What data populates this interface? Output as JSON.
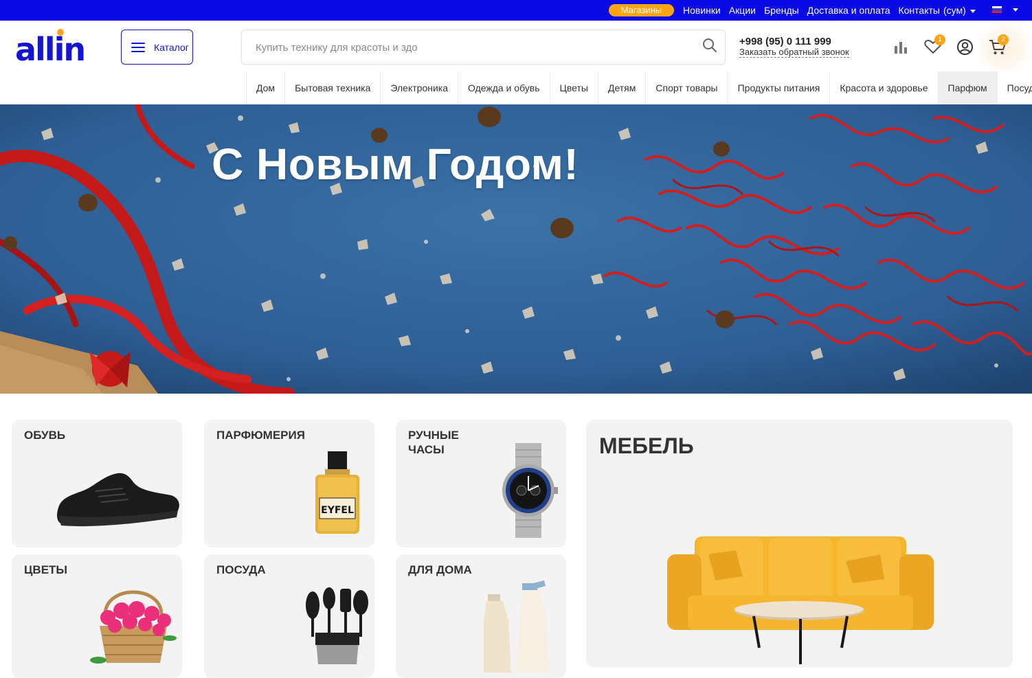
{
  "topbar": {
    "stores_label": "Магазины",
    "links": [
      "Новинки",
      "Акции",
      "Бренды",
      "Доставка и оплата",
      "Контакты"
    ],
    "currency": "(сум)"
  },
  "header": {
    "logo_text": "allin",
    "catalog_label": "Каталог",
    "search_placeholder": "Купить технику для красоты и здо",
    "phone": "+998 (95) 0 111 999",
    "callback": "Заказать обратный звонок",
    "favorites_count": "1",
    "cart_count": "2"
  },
  "catnav": {
    "items": [
      {
        "label": "Дом",
        "active": false
      },
      {
        "label": "Бытовая техника",
        "active": false
      },
      {
        "label": "Электроника",
        "active": false
      },
      {
        "label": "Одежда и обувь",
        "active": false
      },
      {
        "label": "Цветы",
        "active": false
      },
      {
        "label": "Детям",
        "active": false
      },
      {
        "label": "Спорт товары",
        "active": false
      },
      {
        "label": "Продукты питания",
        "active": false
      },
      {
        "label": "Красота и здоровье",
        "active": false
      },
      {
        "label": "Парфюм",
        "active": true
      },
      {
        "label": "Посуда",
        "active": false
      }
    ]
  },
  "banner": {
    "title": "С Новым Годом!"
  },
  "tiles": {
    "shoes": "ОБУВЬ",
    "perfume": "ПАРФЮМЕРИЯ",
    "watches_line1": "РУЧНЫЕ",
    "watches_line2": "ЧАСЫ",
    "furniture": "МЕБЕЛЬ",
    "flowers": "ЦВЕТЫ",
    "dishes": "ПОСУДА",
    "home": "ДЛЯ ДОМА",
    "perfume_bottle_text": "EYFEL"
  },
  "colors": {
    "brand_blue": "#0a0ae6",
    "accent_orange": "#ffa514",
    "tile_bg": "#f3f3f3"
  }
}
